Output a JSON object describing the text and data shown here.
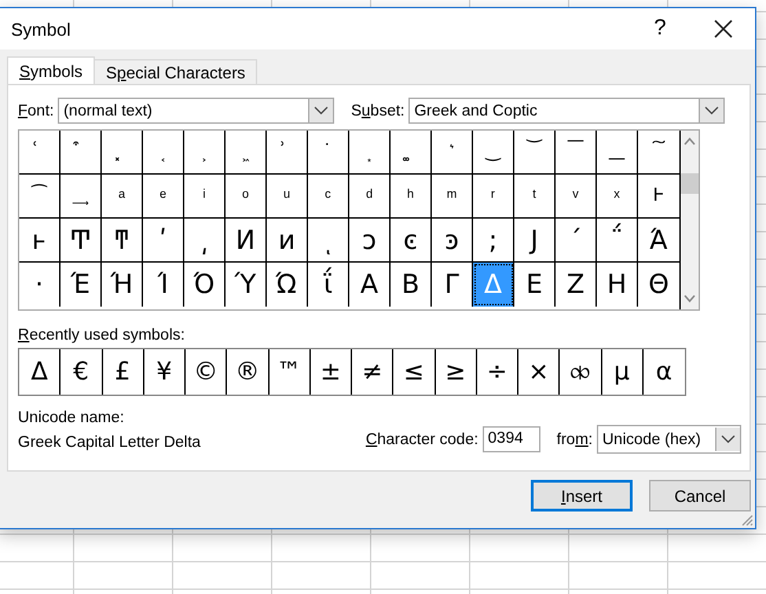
{
  "window": {
    "title": "Symbol",
    "help": "?"
  },
  "tabs": [
    {
      "label": {
        "key": "S",
        "post": "ymbols"
      },
      "selected": true
    },
    {
      "label": {
        "pre": "S",
        "key": "p",
        "post": "ecial Characters"
      },
      "selected": false
    }
  ],
  "font": {
    "label": {
      "key": "F",
      "post": "ont:"
    },
    "value": "(normal text)"
  },
  "subset": {
    "label": {
      "pre": "S",
      "key": "u",
      "post": "bset:"
    },
    "value": "Greek and Coptic"
  },
  "symbols": [
    [
      {
        "ch": "͑",
        "selected": false
      },
      {
        "ch": "͒",
        "selected": false
      },
      {
        "ch": "͓",
        "selected": false
      },
      {
        "ch": "͔",
        "selected": false
      },
      {
        "ch": "͕",
        "selected": false
      },
      {
        "ch": "͖",
        "selected": false
      },
      {
        "ch": "͗",
        "selected": false
      },
      {
        "ch": "͘",
        "selected": false
      },
      {
        "ch": "͙",
        "selected": false
      },
      {
        "ch": "͚",
        "selected": false
      },
      {
        "ch": "͛",
        "selected": false
      },
      {
        "ch": "͜",
        "selected": false
      },
      {
        "ch": "͝",
        "selected": false
      },
      {
        "ch": "͞",
        "selected": false
      },
      {
        "ch": "͟",
        "selected": false
      },
      {
        "ch": "͠",
        "selected": false
      }
    ],
    [
      {
        "ch": "͡",
        "selected": false
      },
      {
        "ch": "͢",
        "selected": false
      },
      {
        "ch": "ͣ",
        "selected": false
      },
      {
        "ch": "ͤ",
        "selected": false
      },
      {
        "ch": "ͥ",
        "selected": false
      },
      {
        "ch": "ͦ",
        "selected": false
      },
      {
        "ch": "ͧ",
        "selected": false
      },
      {
        "ch": "ͨ",
        "selected": false
      },
      {
        "ch": "ͩ",
        "selected": false
      },
      {
        "ch": "ͪ",
        "selected": false
      },
      {
        "ch": "ͫ",
        "selected": false
      },
      {
        "ch": "ͬ",
        "selected": false
      },
      {
        "ch": "ͭ",
        "selected": false
      },
      {
        "ch": "ͮ",
        "selected": false
      },
      {
        "ch": "ͯ",
        "selected": false
      },
      {
        "ch": "Ͱ",
        "selected": false
      }
    ],
    [
      {
        "ch": "ͱ",
        "selected": false
      },
      {
        "ch": "Ͳ",
        "selected": false
      },
      {
        "ch": "ͳ",
        "selected": false
      },
      {
        "ch": "ʹ",
        "selected": false
      },
      {
        "ch": "͵",
        "selected": false
      },
      {
        "ch": "Ͷ",
        "selected": false
      },
      {
        "ch": "ͷ",
        "selected": false
      },
      {
        "ch": "ͺ",
        "selected": false
      },
      {
        "ch": "ͻ",
        "selected": false
      },
      {
        "ch": "ͼ",
        "selected": false
      },
      {
        "ch": "ͽ",
        "selected": false
      },
      {
        "ch": ";",
        "selected": false
      },
      {
        "ch": "Ϳ",
        "selected": false
      },
      {
        "ch": "΄",
        "selected": false
      },
      {
        "ch": "΅",
        "selected": false
      },
      {
        "ch": "Ά",
        "selected": false
      }
    ],
    [
      {
        "ch": "·",
        "selected": false
      },
      {
        "ch": "Έ",
        "selected": false
      },
      {
        "ch": "Ή",
        "selected": false
      },
      {
        "ch": "Ί",
        "selected": false
      },
      {
        "ch": "Ό",
        "selected": false
      },
      {
        "ch": "Ύ",
        "selected": false
      },
      {
        "ch": "Ώ",
        "selected": false
      },
      {
        "ch": "ΐ",
        "selected": false
      },
      {
        "ch": "Α",
        "selected": false
      },
      {
        "ch": "Β",
        "selected": false
      },
      {
        "ch": "Γ",
        "selected": false
      },
      {
        "ch": "Δ",
        "selected": true
      },
      {
        "ch": "Ε",
        "selected": false
      },
      {
        "ch": "Ζ",
        "selected": false
      },
      {
        "ch": "Η",
        "selected": false
      },
      {
        "ch": "Θ",
        "selected": false
      }
    ]
  ],
  "recent": {
    "label": {
      "key": "R",
      "post": "ecently used symbols:"
    },
    "items": [
      "Δ",
      "€",
      "£",
      "¥",
      "©",
      "®",
      "™",
      "±",
      "≠",
      "≤",
      "≥",
      "÷",
      "×",
      "⧞",
      "µ",
      "α"
    ]
  },
  "unicode_name": {
    "label": "Unicode name:",
    "value": "Greek Capital Letter Delta"
  },
  "character_code": {
    "label": {
      "key": "C",
      "post": "haracter code:"
    },
    "value": "0394"
  },
  "from": {
    "label": {
      "pre": "fro",
      "key": "m",
      "post": ":"
    },
    "value": "Unicode (hex)"
  },
  "buttons": [
    {
      "label": {
        "key": "I",
        "post": "nsert"
      },
      "default": true
    },
    {
      "label": {
        "pre": "Cancel"
      },
      "default": false
    }
  ]
}
